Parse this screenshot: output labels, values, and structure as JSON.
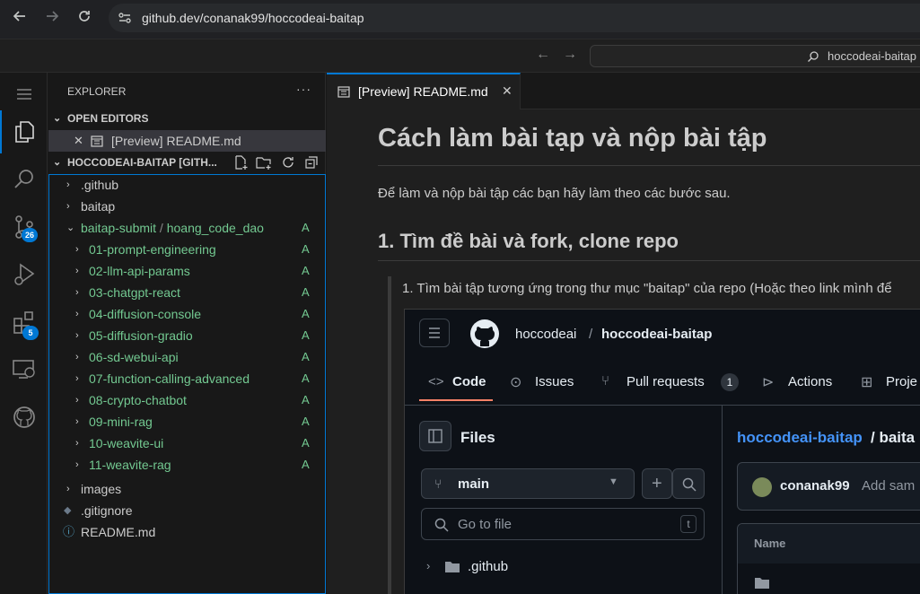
{
  "browser": {
    "url": "github.dev/conanak99/hoccodeai-baitap",
    "back_icon": "arrow-left-icon",
    "forward_icon": "arrow-right-icon",
    "reload_icon": "reload-icon"
  },
  "titlebar": {
    "command_center": "hoccodeai-baitap"
  },
  "activity": {
    "scm_badge": "26",
    "extensions_badge": "5"
  },
  "explorer": {
    "title": "EXPLORER",
    "more": "···",
    "open_editors": "OPEN EDITORS",
    "open_editor_item": "[Preview] README.md",
    "repo": "HOCCODEAI-BAITAP [GITH...",
    "tree": [
      {
        "label": ".github",
        "type": "folder"
      },
      {
        "label": "baitap",
        "type": "folder"
      },
      {
        "label": "baitap-submit",
        "sub": "hoang_code_dao",
        "type": "folder-open",
        "status": "A"
      },
      {
        "label": "01-prompt-engineering",
        "type": "child",
        "status": "A"
      },
      {
        "label": "02-llm-api-params",
        "type": "child",
        "status": "A"
      },
      {
        "label": "03-chatgpt-react",
        "type": "child",
        "status": "A"
      },
      {
        "label": "04-diffusion-console",
        "type": "child",
        "status": "A"
      },
      {
        "label": "05-diffusion-gradio",
        "type": "child",
        "status": "A"
      },
      {
        "label": "06-sd-webui-api",
        "type": "child",
        "status": "A"
      },
      {
        "label": "07-function-calling-advanced",
        "type": "child",
        "status": "A"
      },
      {
        "label": "08-crypto-chatbot",
        "type": "child",
        "status": "A"
      },
      {
        "label": "09-mini-rag",
        "type": "child",
        "status": "A"
      },
      {
        "label": "10-weavite-ui",
        "type": "child",
        "status": "A"
      },
      {
        "label": "11-weavite-rag",
        "type": "child",
        "status": "A"
      },
      {
        "label": "images",
        "type": "folder"
      },
      {
        "label": ".gitignore",
        "type": "file"
      },
      {
        "label": "README.md",
        "type": "file"
      }
    ]
  },
  "editor": {
    "tab_label": "[Preview] README.md",
    "h1": "Cách làm bài tạp và nộp bài tập",
    "intro": "Để làm và nộp bài tập các bạn hãy làm theo các bước sau.",
    "h2": "1. Tìm đề bài và fork, clone repo",
    "step1": "1. Tìm bài tập tương ứng trong thư mục \"baitap\" của repo (Hoặc theo link mình để"
  },
  "github_shot": {
    "owner": "hoccodeai",
    "sep": "/",
    "repo": "hoccodeai-baitap",
    "tabs": [
      {
        "label": "Code"
      },
      {
        "label": "Issues"
      },
      {
        "label": "Pull requests",
        "count": "1"
      },
      {
        "label": "Actions"
      },
      {
        "label": "Proje"
      }
    ],
    "files_title": "Files",
    "branch": "main",
    "goto_placeholder": "Go to file",
    "goto_key": "t",
    "first_item": ".github",
    "breadcrumb_repo": "hoccodeai-baitap",
    "breadcrumb_rest": " / baita",
    "commit_user": "conanak99",
    "commit_msg": "Add sam",
    "table_header": "Name"
  }
}
